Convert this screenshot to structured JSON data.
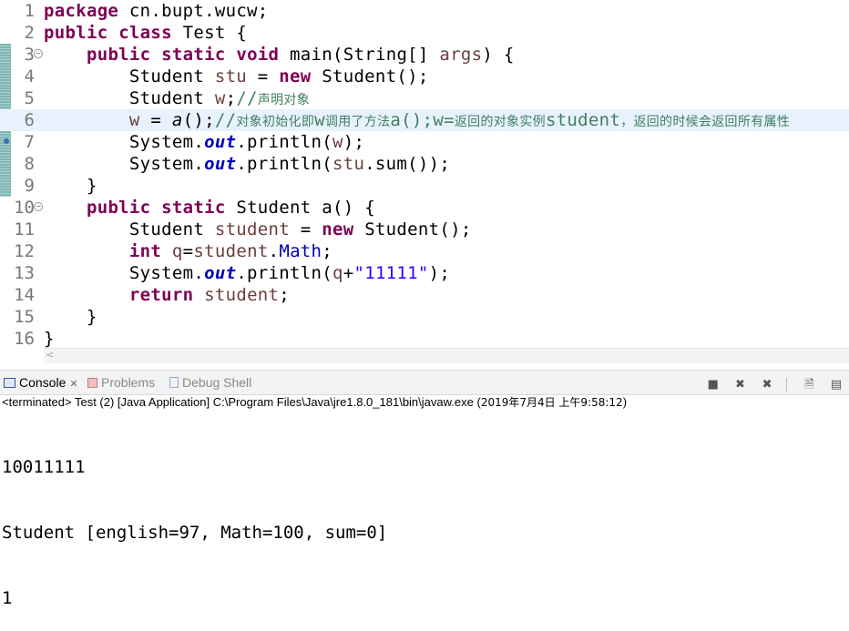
{
  "editor": {
    "lines": [
      {
        "n": "1",
        "tokens": [
          [
            "kw",
            "package"
          ],
          [
            "t",
            " cn.bupt.wucw;"
          ]
        ]
      },
      {
        "n": "2",
        "tokens": [
          [
            "kw",
            "public"
          ],
          [
            "t",
            " "
          ],
          [
            "kw",
            "class"
          ],
          [
            "t",
            " Test {"
          ]
        ]
      },
      {
        "n": "3",
        "fold": "−",
        "tokens": [
          [
            "t",
            "    "
          ],
          [
            "kw",
            "public"
          ],
          [
            "t",
            " "
          ],
          [
            "kw",
            "static"
          ],
          [
            "t",
            " "
          ],
          [
            "kw",
            "void"
          ],
          [
            "t",
            " main(String[] "
          ],
          [
            "var",
            "args"
          ],
          [
            "t",
            ") {"
          ]
        ]
      },
      {
        "n": "4",
        "tokens": [
          [
            "t",
            "        Student "
          ],
          [
            "var",
            "stu"
          ],
          [
            "t",
            " = "
          ],
          [
            "kw",
            "new"
          ],
          [
            "t",
            " Student();"
          ]
        ]
      },
      {
        "n": "5",
        "tokens": [
          [
            "t",
            "        Student "
          ],
          [
            "var",
            "w"
          ],
          [
            "t",
            ";"
          ],
          [
            "cmt",
            "//"
          ],
          [
            "cmtcjk",
            "声明对象"
          ]
        ]
      },
      {
        "n": "6",
        "current": true,
        "tokens": [
          [
            "t",
            "        "
          ],
          [
            "var",
            "w"
          ],
          [
            "t",
            " = "
          ],
          [
            "mcall",
            "a"
          ],
          [
            "t",
            "();"
          ],
          [
            "cmt",
            "//"
          ],
          [
            "cmtcjk",
            "对象初始化即"
          ],
          [
            "cmt",
            "w"
          ],
          [
            "cmtcjk",
            "调用了方法"
          ],
          [
            "cmt",
            "a();w="
          ],
          [
            "cmtcjk",
            "返回的对象实例"
          ],
          [
            "cmt",
            "student"
          ],
          [
            "cmtcjk",
            "，返回的时候会返回所有属性"
          ]
        ]
      },
      {
        "n": "7",
        "tokens": [
          [
            "t",
            "        System."
          ],
          [
            "sfld",
            "out"
          ],
          [
            "t",
            ".println("
          ],
          [
            "var",
            "w"
          ],
          [
            "t",
            ");"
          ]
        ]
      },
      {
        "n": "8",
        "tokens": [
          [
            "t",
            "        System."
          ],
          [
            "sfld",
            "out"
          ],
          [
            "t",
            ".println("
          ],
          [
            "var",
            "stu"
          ],
          [
            "t",
            ".sum());"
          ]
        ]
      },
      {
        "n": "9",
        "tokens": [
          [
            "t",
            "    }"
          ]
        ]
      },
      {
        "n": "10",
        "fold": "−",
        "tokens": [
          [
            "t",
            "    "
          ],
          [
            "kw",
            "public"
          ],
          [
            "t",
            " "
          ],
          [
            "kw",
            "static"
          ],
          [
            "t",
            " Student a() {"
          ]
        ]
      },
      {
        "n": "11",
        "tokens": [
          [
            "t",
            "        Student "
          ],
          [
            "var",
            "student"
          ],
          [
            "t",
            " = "
          ],
          [
            "kw",
            "new"
          ],
          [
            "t",
            " Student();"
          ]
        ]
      },
      {
        "n": "12",
        "tokens": [
          [
            "t",
            "        "
          ],
          [
            "kw",
            "int"
          ],
          [
            "t",
            " "
          ],
          [
            "var",
            "q"
          ],
          [
            "t",
            "="
          ],
          [
            "var",
            "student"
          ],
          [
            "t",
            "."
          ],
          [
            "fld",
            "Math"
          ],
          [
            "t",
            ";"
          ]
        ]
      },
      {
        "n": "13",
        "tokens": [
          [
            "t",
            "        System."
          ],
          [
            "sfld",
            "out"
          ],
          [
            "t",
            ".println("
          ],
          [
            "var",
            "q"
          ],
          [
            "t",
            "+"
          ],
          [
            "str",
            "\"11111\""
          ],
          [
            "t",
            ");"
          ]
        ]
      },
      {
        "n": "14",
        "tokens": [
          [
            "t",
            "        "
          ],
          [
            "kw",
            "return"
          ],
          [
            "t",
            " "
          ],
          [
            "var",
            "student"
          ],
          [
            "t",
            ";"
          ]
        ]
      },
      {
        "n": "15",
        "tokens": [
          [
            "t",
            "    }"
          ]
        ]
      },
      {
        "n": "16",
        "tokens": [
          [
            "t",
            "}"
          ]
        ]
      }
    ]
  },
  "tabs": [
    {
      "label": "Console",
      "active": true,
      "closable": true,
      "icon": "console-icon"
    },
    {
      "label": "Problems",
      "active": false,
      "icon": "problems-icon"
    },
    {
      "label": "Debug Shell",
      "active": false,
      "icon": "debug-shell-icon"
    }
  ],
  "toolbar": {
    "icons": [
      "terminate-icon",
      "remove-launch-icon",
      "remove-all-icon",
      "clear-console-icon",
      "scroll-lock-icon"
    ]
  },
  "console": {
    "status_prefix": "<terminated> Test (2) [Java Application] C:\\Program Files\\Java\\jre1.8.0_181\\bin\\javaw.exe (",
    "status_date": "2019年7月4日 上午9:58:12",
    "status_suffix": ")",
    "output": [
      "10011111",
      "Student [english=97, Math=100, sum=0]",
      "1"
    ]
  },
  "colors": {
    "keyword": "#7f0055",
    "local_var": "#6a3e3e",
    "field": "#0000c0",
    "string": "#2a00ff",
    "comment": "#3f7f5f",
    "current_line": "#e8f2fe",
    "change_ruler": "#7fb7b3"
  }
}
